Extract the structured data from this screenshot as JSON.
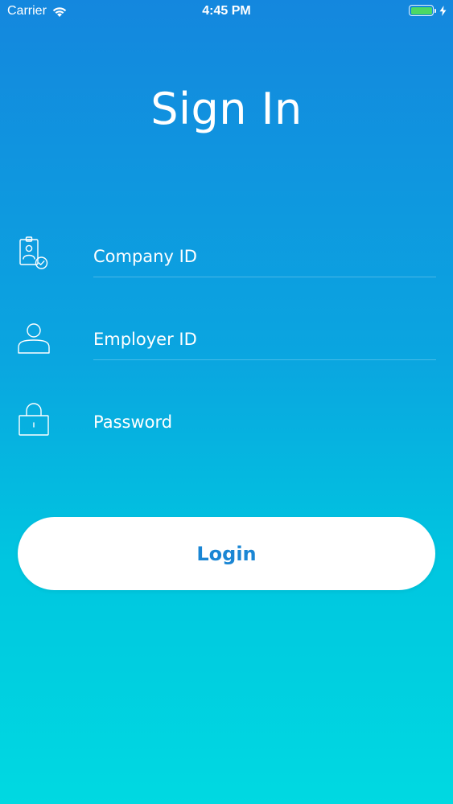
{
  "status_bar": {
    "carrier": "Carrier",
    "time": "4:45 PM",
    "battery_color": "#4cd964"
  },
  "title": "Sign In",
  "fields": [
    {
      "icon": "badge-check-icon",
      "placeholder": "Company ID"
    },
    {
      "icon": "user-icon",
      "placeholder": "Employer ID"
    },
    {
      "icon": "lock-icon",
      "placeholder": "Password"
    }
  ],
  "login_button": {
    "label": "Login",
    "color": "#1a86d4"
  },
  "colors": {
    "gradient_top": "#1487de",
    "gradient_bottom": "#00d9e1"
  }
}
